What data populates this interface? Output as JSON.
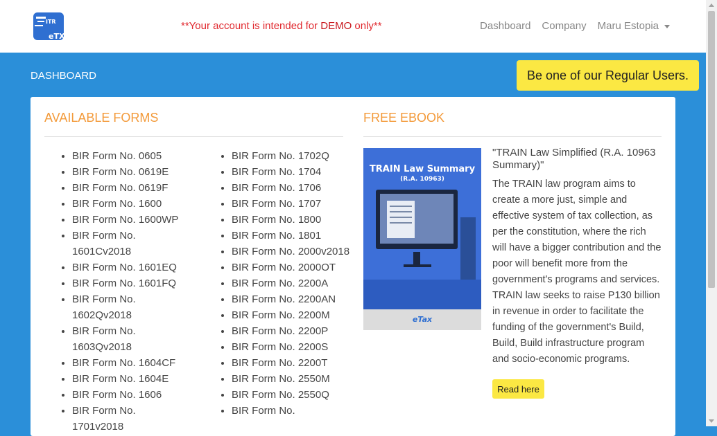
{
  "demo": {
    "prefix": "**Your account is intended for ",
    "strong": "DEMO",
    "suffix": " only**"
  },
  "nav": {
    "dashboard": "Dashboard",
    "company": "Company",
    "user": "Maru Estopia"
  },
  "dashboard_label": "DASHBOARD",
  "cta_label": "Be one of our Regular Users.",
  "forms": {
    "title": "AVAILABLE FORMS",
    "col1": [
      "BIR Form No. 0605",
      "BIR Form No. 0619E",
      "BIR Form No. 0619F",
      "BIR Form No. 1600",
      "BIR Form No. 1600WP",
      "BIR Form No. 1601Cv2018",
      "BIR Form No. 1601EQ",
      "BIR Form No. 1601FQ",
      "BIR Form No. 1602Qv2018",
      "BIR Form No. 1603Qv2018",
      "BIR Form No. 1604CF",
      "BIR Form No. 1604E",
      "BIR Form No. 1606",
      "BIR Form No. 1701v2018"
    ],
    "col2": [
      "BIR Form No. 1702Q",
      "BIR Form No. 1704",
      "BIR Form No. 1706",
      "BIR Form No. 1707",
      "BIR Form No. 1800",
      "BIR Form No. 1801",
      "BIR Form No. 2000v2018",
      "BIR Form No. 2000OT",
      "BIR Form No. 2200A",
      "BIR Form No. 2200AN",
      "BIR Form No. 2200M",
      "BIR Form No. 2200P",
      "BIR Form No. 2200S",
      "BIR Form No. 2200T",
      "BIR Form No. 2550M",
      "BIR Form No. 2550Q",
      "BIR Form No."
    ]
  },
  "ebook": {
    "title": "FREE EBOOK",
    "cover_title": "TRAIN Law Summary",
    "cover_subtitle": "(R.A. 10963)",
    "cover_brand": "eTax",
    "book_title": "\"TRAIN Law Simplified (R.A. 10963 Summary)\"",
    "description": "The TRAIN law program aims to create a more just, simple and effective system of tax collection, as per the constitution, where the rich will have a bigger contribution and the poor will benefit more from the government's programs and services. TRAIN law seeks to raise P130 billion in revenue in order to facilitate the funding of the government's Build, Build, Build infrastructure program and socio-economic programs.",
    "button": "Read here"
  },
  "colors": {
    "primary": "#2b8fd9",
    "accent": "#f39a3a",
    "highlight": "#fbe843",
    "demo": "#e0282e"
  }
}
